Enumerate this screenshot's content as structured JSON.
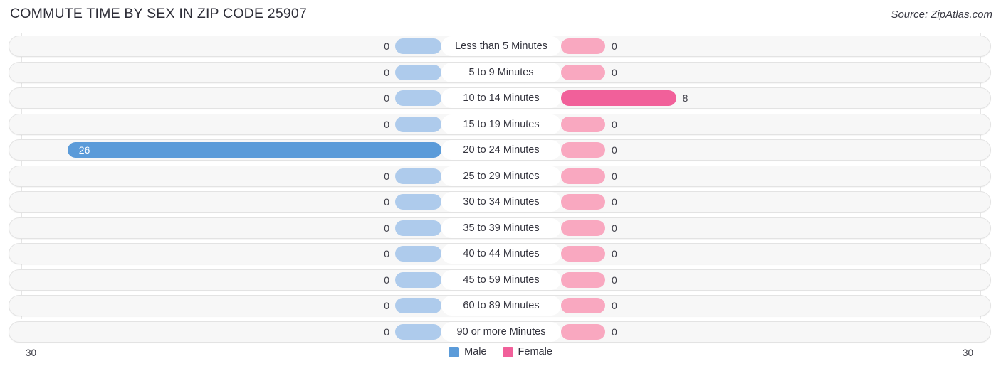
{
  "header": {
    "title": "COMMUTE TIME BY SEX IN ZIP CODE 25907",
    "source": "Source: ZipAtlas.com"
  },
  "axis": {
    "left_label": "30",
    "right_label": "30"
  },
  "legend": {
    "items": [
      {
        "label": "Male",
        "color": "#5b9bd9"
      },
      {
        "label": "Female",
        "color": "#f1609a"
      }
    ]
  },
  "colors": {
    "male_light": "#aecbec",
    "male_strong": "#5b9bd9",
    "female_light": "#f9a8c0",
    "female_strong": "#f1609a",
    "track": "#f7f7f7",
    "track_border": "#e3e3e3"
  },
  "chart_data": {
    "type": "bar",
    "title": "COMMUTE TIME BY SEX IN ZIP CODE 25907",
    "orientation": "horizontal-diverging",
    "xlabel": "",
    "ylabel": "",
    "xlim": [
      30,
      30
    ],
    "grid": true,
    "legend_position": "bottom-center",
    "categories": [
      "Less than 5 Minutes",
      "5 to 9 Minutes",
      "10 to 14 Minutes",
      "15 to 19 Minutes",
      "20 to 24 Minutes",
      "25 to 29 Minutes",
      "30 to 34 Minutes",
      "35 to 39 Minutes",
      "40 to 44 Minutes",
      "45 to 59 Minutes",
      "60 to 89 Minutes",
      "90 or more Minutes"
    ],
    "series": [
      {
        "name": "Male",
        "values": [
          0,
          0,
          0,
          0,
          26,
          0,
          0,
          0,
          0,
          0,
          0,
          0
        ]
      },
      {
        "name": "Female",
        "values": [
          0,
          0,
          8,
          0,
          0,
          0,
          0,
          0,
          0,
          0,
          0,
          0
        ]
      }
    ],
    "rows": [
      {
        "category": "Less than 5 Minutes",
        "male": "0",
        "female": "0"
      },
      {
        "category": "5 to 9 Minutes",
        "male": "0",
        "female": "0"
      },
      {
        "category": "10 to 14 Minutes",
        "male": "0",
        "female": "8"
      },
      {
        "category": "15 to 19 Minutes",
        "male": "0",
        "female": "0"
      },
      {
        "category": "20 to 24 Minutes",
        "male": "26",
        "female": "0"
      },
      {
        "category": "25 to 29 Minutes",
        "male": "0",
        "female": "0"
      },
      {
        "category": "30 to 34 Minutes",
        "male": "0",
        "female": "0"
      },
      {
        "category": "35 to 39 Minutes",
        "male": "0",
        "female": "0"
      },
      {
        "category": "40 to 44 Minutes",
        "male": "0",
        "female": "0"
      },
      {
        "category": "45 to 59 Minutes",
        "male": "0",
        "female": "0"
      },
      {
        "category": "60 to 89 Minutes",
        "male": "0",
        "female": "0"
      },
      {
        "category": "90 or more Minutes",
        "male": "0",
        "female": "0"
      }
    ]
  }
}
